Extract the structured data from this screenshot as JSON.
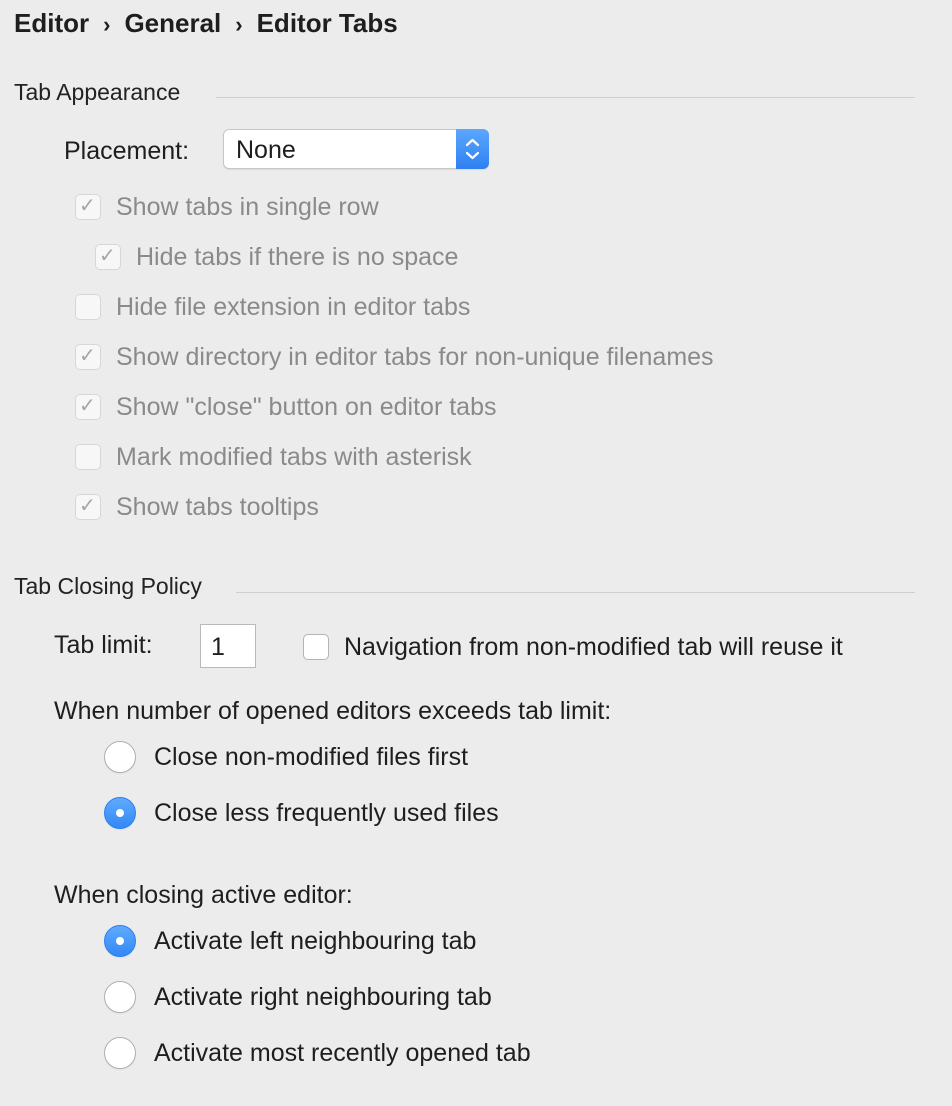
{
  "breadcrumb": [
    "Editor",
    "General",
    "Editor Tabs"
  ],
  "breadcrumb_separator": "›",
  "tab_appearance": {
    "title": "Tab Appearance",
    "placement_label": "Placement:",
    "placement_value": "None",
    "options": [
      {
        "label": "Show tabs in single row",
        "checked": true
      },
      {
        "label": "Hide tabs if there is no space",
        "checked": true
      },
      {
        "label": "Hide file extension in editor tabs",
        "checked": false
      },
      {
        "label": "Show directory in editor tabs for non-unique filenames",
        "checked": true
      },
      {
        "label": "Show \"close\" button on editor tabs",
        "checked": true
      },
      {
        "label": "Mark modified tabs with asterisk",
        "checked": false
      },
      {
        "label": "Show tabs tooltips",
        "checked": true
      }
    ]
  },
  "tab_closing": {
    "title": "Tab Closing Policy",
    "tab_limit_label": "Tab limit:",
    "tab_limit_value": "1",
    "reuse_label": "Navigation from non-modified tab will reuse it",
    "reuse_checked": false,
    "exceeds_label": "When number of opened editors exceeds tab limit:",
    "exceeds_options": [
      {
        "label": "Close non-modified files first",
        "selected": false
      },
      {
        "label": "Close less frequently used files",
        "selected": true
      }
    ],
    "closing_label": "When closing active editor:",
    "closing_options": [
      {
        "label": "Activate left neighbouring tab",
        "selected": true
      },
      {
        "label": "Activate right neighbouring tab",
        "selected": false
      },
      {
        "label": "Activate most recently opened tab",
        "selected": false
      }
    ]
  },
  "icons": {
    "check": "✓",
    "select_arrows": "chevron-up-down-icon"
  },
  "colors": {
    "accent": "#3388f6",
    "background": "#ececec",
    "disabled_text": "#8a8a8a"
  }
}
